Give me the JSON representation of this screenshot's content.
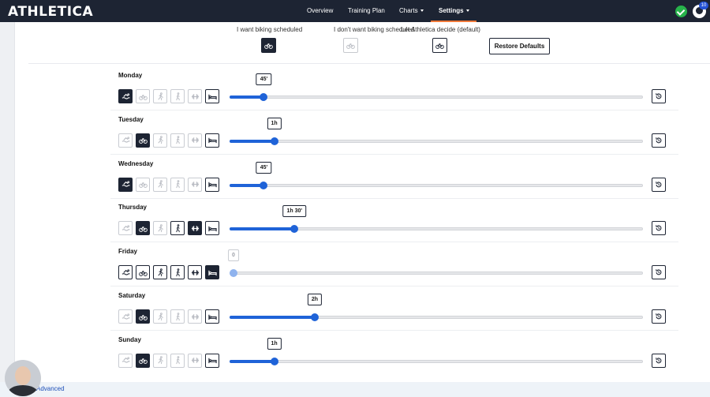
{
  "app": {
    "logo": "ATHLETICA"
  },
  "nav": {
    "items": [
      {
        "label": "Overview",
        "has_menu": false,
        "active": false
      },
      {
        "label": "Training Plan",
        "has_menu": false,
        "active": false
      },
      {
        "label": "Charts",
        "has_menu": true,
        "active": false
      },
      {
        "label": "Settings",
        "has_menu": true,
        "active": true
      }
    ],
    "notification_count": "10",
    "accent_color": "#f07a3a"
  },
  "legend": {
    "want_label": "I want biking scheduled",
    "dont_want_label": "I don't want biking scheduled",
    "let_decide_label": "Let Athletica decide (default)",
    "restore_label": "Restore Defaults"
  },
  "sports": [
    "swim-icon",
    "bike-icon",
    "run-icon",
    "walk-icon",
    "strength-icon",
    "rest-icon"
  ],
  "days": [
    {
      "name": "Monday",
      "duration": "45'",
      "fraction": 0.083,
      "states": [
        "on",
        "off",
        "off",
        "off",
        "off",
        "outline"
      ]
    },
    {
      "name": "Tuesday",
      "duration": "1h",
      "fraction": 0.108,
      "states": [
        "off",
        "on",
        "off",
        "off",
        "off",
        "outline"
      ]
    },
    {
      "name": "Wednesday",
      "duration": "45'",
      "fraction": 0.083,
      "states": [
        "on",
        "off",
        "off",
        "off",
        "off",
        "outline"
      ]
    },
    {
      "name": "Thursday",
      "duration": "1h 30'",
      "fraction": 0.157,
      "states": [
        "off",
        "on",
        "off",
        "outline",
        "on",
        "outline"
      ]
    },
    {
      "name": "Friday",
      "duration": "0",
      "fraction": 0.0,
      "states": [
        "outline",
        "outline",
        "outline",
        "outline",
        "outline",
        "on"
      ]
    },
    {
      "name": "Saturday",
      "duration": "2h",
      "fraction": 0.206,
      "states": [
        "off",
        "on",
        "off",
        "off",
        "off",
        "outline"
      ]
    },
    {
      "name": "Sunday",
      "duration": "1h",
      "fraction": 0.108,
      "states": [
        "off",
        "on",
        "off",
        "off",
        "off",
        "outline"
      ]
    }
  ],
  "footer": {
    "advanced_label": "Advanced"
  },
  "colors": {
    "navy": "#1d2433",
    "blue": "#1f63d8",
    "green": "#27b34b"
  }
}
